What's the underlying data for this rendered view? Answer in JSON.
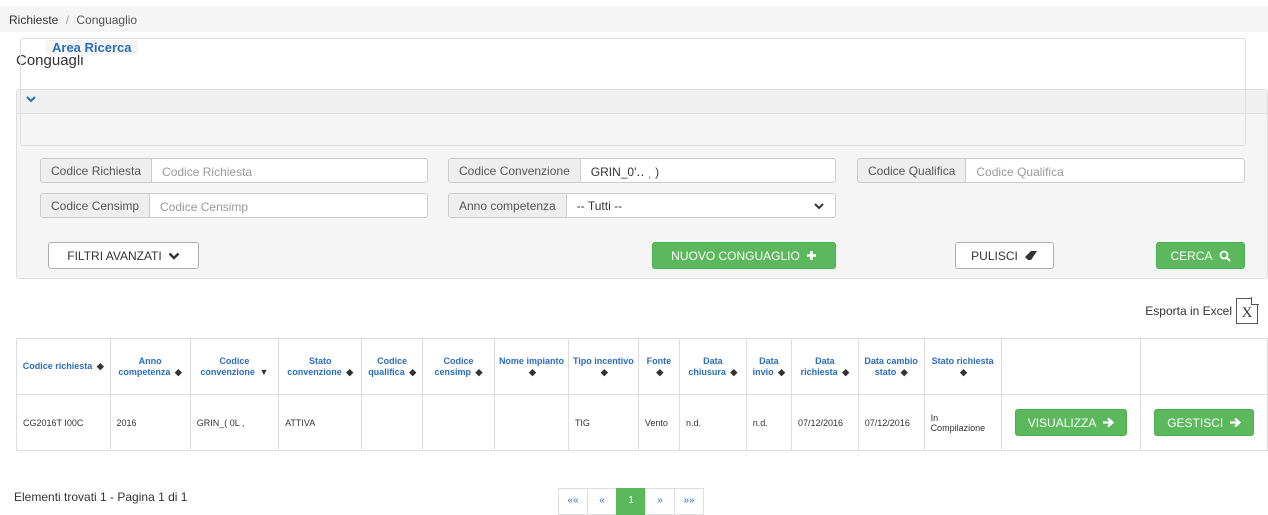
{
  "breadcrumb": {
    "root": "Richieste",
    "separator": "/",
    "current": "Conguaglio"
  },
  "page_title": "Conguagli",
  "search": {
    "legend": "Area Ricerca",
    "codice_richiesta": {
      "label": "Codice Richiesta",
      "placeholder": "Codice Richiesta",
      "value": ""
    },
    "codice_convenzione": {
      "label": "Codice Convenzione",
      "value": "GRIN_0'‥ ˌ )"
    },
    "codice_qualifica": {
      "label": "Codice Qualifica",
      "placeholder": "Codice Qualifica",
      "value": ""
    },
    "codice_censimp": {
      "label": "Codice Censimp",
      "placeholder": "Codice Censimp",
      "value": ""
    },
    "anno_competenza": {
      "label": "Anno competenza",
      "selected": "-- Tutti --"
    }
  },
  "buttons": {
    "filtri_avanzati": "FILTRI AVANZATI",
    "nuovo_conguaglio": "NUOVO CONGUAGLIO",
    "pulisci": "PULISCI",
    "cerca": "CERCA"
  },
  "export_label": "Esporta in Excel",
  "export_icon_text": "X",
  "table": {
    "columns": [
      "Codice richiesta",
      "Anno competenza",
      "Codice convenzione",
      "Stato convenzione",
      "Codice qualifica",
      "Codice censimp",
      "Nome impianto",
      "Tipo incentivo",
      "Fonte",
      "Data chiusura",
      "Data invio",
      "Data richiesta",
      "Data cambio stato",
      "Stato richiesta"
    ],
    "rows": [
      {
        "codice_richiesta": "CG2016T  I00C",
        "anno_competenza": "2016",
        "codice_convenzione": "GRIN_(  0L ,",
        "stato_convenzione": "ATTIVA",
        "codice_qualifica": "",
        "codice_censimp": "",
        "nome_impianto": "",
        "tipo_incentivo": "TIG",
        "fonte": "Vento",
        "data_chiusura": "n.d.",
        "data_invio": "n.d.",
        "data_richiesta": "07/12/2016",
        "data_cambio_stato": "07/12/2016",
        "stato_richiesta": "In Compilazione",
        "visualizza": "VISUALIZZA",
        "gestisci": "GESTISCI"
      }
    ]
  },
  "footer": {
    "status": "Elementi trovati 1 - Pagina 1 di 1"
  },
  "pagination": {
    "first": "««",
    "prev": "«",
    "current": "1",
    "next": "»",
    "last": "»»"
  },
  "colors": {
    "accent": "#2a6ebb",
    "success": "#5cb85c"
  }
}
